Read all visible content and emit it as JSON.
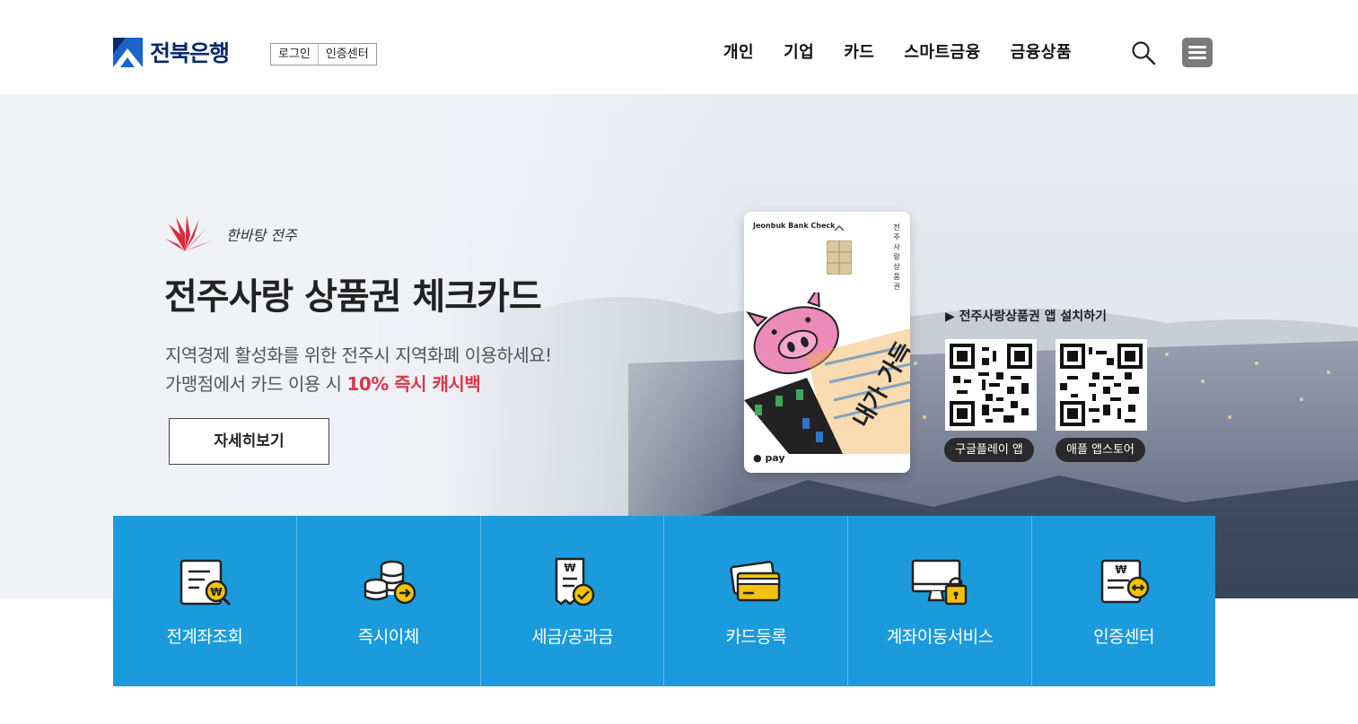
{
  "header": {
    "logo_text": "전북은행",
    "util_links": [
      "로그인",
      "인증센터"
    ],
    "nav": [
      "개인",
      "기업",
      "카드",
      "스마트금융",
      "금융상품"
    ],
    "search_icon": "search-icon",
    "menu_icon": "hamburger-menu-icon"
  },
  "hero": {
    "brand_sign": "한바탕 전주",
    "title": "전주사랑 상품권 체크카드",
    "desc_line1": "지역경제 활성화를 위한 전주시 지역화폐 이용하세요!",
    "desc_line2_prefix": "가맹점에서 카드 이용 시 ",
    "desc_line2_highlight": "10% 즉시 캐시백",
    "detail_button": "자세히보기",
    "card": {
      "brand": "Jeonbuk Bank Check",
      "vertical_text": "전주사랑상품권",
      "pay": "pay"
    },
    "qr_title": "▶ 전주사랑상품권 앱 설치하기",
    "qr_labels": [
      "구글플레이 앱",
      "애플 앱스토어"
    ],
    "highlight_color": "#d8384d"
  },
  "quick_menu": {
    "accent_color": "#1b9bdb",
    "items": [
      {
        "label": "전계좌조회",
        "icon": "document-search-icon"
      },
      {
        "label": "즉시이체",
        "icon": "coins-transfer-icon"
      },
      {
        "label": "세금/공과금",
        "icon": "receipt-check-icon"
      },
      {
        "label": "카드등록",
        "icon": "credit-card-icon"
      },
      {
        "label": "계좌이동서비스",
        "icon": "monitor-lock-icon"
      },
      {
        "label": "인증센터",
        "icon": "certificate-exchange-icon"
      }
    ]
  }
}
